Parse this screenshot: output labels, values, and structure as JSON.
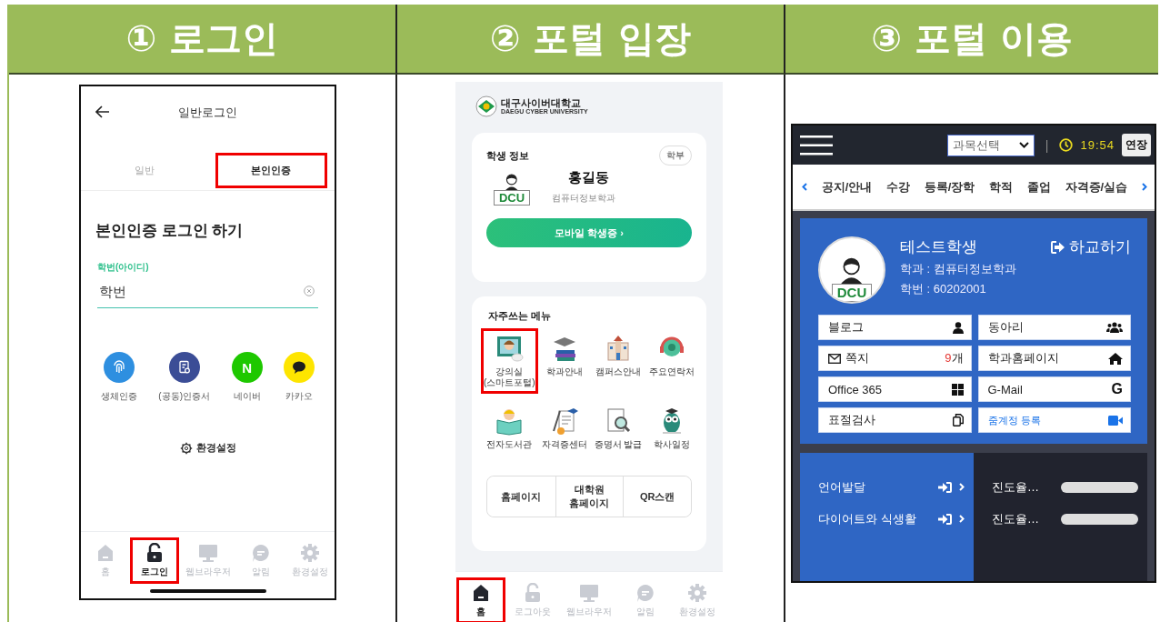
{
  "header": [
    {
      "label": "① 로그인"
    },
    {
      "label": "② 포털 입장"
    },
    {
      "label": "③ 포털 이용"
    }
  ],
  "login": {
    "title": "일반로그인",
    "tabs": [
      {
        "label": "일반",
        "selected": false,
        "highlighted": false
      },
      {
        "label": "본인인증",
        "selected": true,
        "highlighted": true
      }
    ],
    "heading": "본인인증 로그인 하기",
    "field": {
      "label": "학번(아이디)",
      "placeholder": "학번"
    },
    "methods": [
      {
        "label": "생체인증",
        "color": "#2e8fe0"
      },
      {
        "label": "(공동)인증서",
        "color": "#3b4d96"
      },
      {
        "label": "네이버",
        "color": "#1ec800",
        "glyph": "N"
      },
      {
        "label": "카카오",
        "color": "#fee500"
      }
    ],
    "settings": "환경설정",
    "nav": [
      {
        "label": "홈",
        "selected": false,
        "highlighted": false
      },
      {
        "label": "로그인",
        "selected": true,
        "highlighted": true
      },
      {
        "label": "웹브라우저",
        "selected": false,
        "highlighted": false
      },
      {
        "label": "알림",
        "selected": false,
        "highlighted": false
      },
      {
        "label": "환경설정",
        "selected": false,
        "highlighted": false
      }
    ]
  },
  "portal": {
    "logo": {
      "name": "대구사이버대학교",
      "subtitle": "DAEGU CYBER UNIVERSITY"
    },
    "student": {
      "title": "학생 정보",
      "badge": "학부",
      "avatar_text": "DCU",
      "name": "홍길동",
      "department": "컴퓨터정보학과",
      "button": "모바일 학생증 ›"
    },
    "menu_title": "자주쓰는 메뉴",
    "menu": [
      {
        "label": "강의실\n(스마트포털)",
        "highlighted": true
      },
      {
        "label": "학과안내",
        "highlighted": false
      },
      {
        "label": "캠퍼스안내",
        "highlighted": false
      },
      {
        "label": "주요연락처",
        "highlighted": false
      },
      {
        "label": "전자도서관",
        "highlighted": false
      },
      {
        "label": "자격증센터",
        "highlighted": false
      },
      {
        "label": "증명서 발급",
        "highlighted": false
      },
      {
        "label": "학사일정",
        "highlighted": false
      }
    ],
    "links": [
      "홈페이지",
      "대학원\n홈페이지",
      "QR스캔"
    ],
    "nav": [
      {
        "label": "홈",
        "selected": true,
        "highlighted": true
      },
      {
        "label": "로그아웃",
        "selected": false,
        "highlighted": false
      },
      {
        "label": "웹브라우저",
        "selected": false,
        "highlighted": false
      },
      {
        "label": "알림",
        "selected": false,
        "highlighted": false
      },
      {
        "label": "환경설정",
        "selected": false,
        "highlighted": false
      }
    ]
  },
  "use": {
    "course_select": "과목선택",
    "separator": "|",
    "time": "19:54",
    "extend_button": "연장",
    "tabs": [
      "공지/안내",
      "수강",
      "등록/장학",
      "학적",
      "졸업",
      "자격증/실습"
    ],
    "profile": {
      "avatar_text": "DCU",
      "name": "테스트학생",
      "department": "학과 : 컴퓨터정보학과",
      "student_id": "학번 : 60202001",
      "leave_button": "하교하기"
    },
    "links": [
      {
        "label": "블로그",
        "kind": "plain"
      },
      {
        "label": "동아리",
        "kind": "plain"
      },
      {
        "label": "쪽지",
        "kind": "plain",
        "count": "9",
        "unit": "개"
      },
      {
        "label": "학과홈페이지",
        "kind": "plain"
      },
      {
        "label": "Office 365",
        "kind": "plain"
      },
      {
        "label": "G-Mail",
        "kind": "plain",
        "glyph": "G"
      },
      {
        "label": "표절검사",
        "kind": "plain"
      },
      {
        "label": "줌계정 등록",
        "kind": "link"
      }
    ],
    "courses": [
      {
        "name": "언어발달",
        "progress_label": "진도율…",
        "level": 0
      },
      {
        "name": "다이어트와 식생활",
        "progress_label": "진도율…",
        "level": 0
      }
    ]
  }
}
